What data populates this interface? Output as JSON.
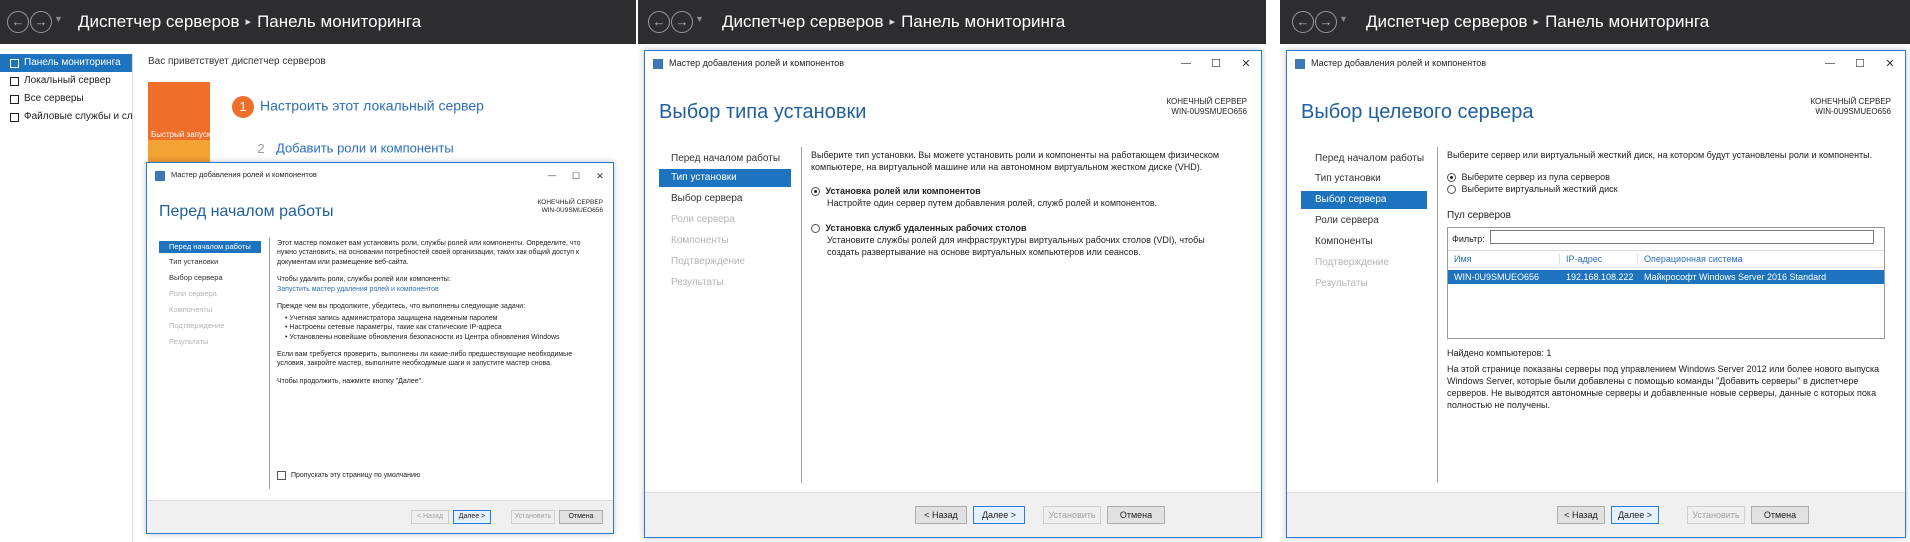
{
  "breadcrumb": {
    "root": "Диспетчер серверов",
    "sep": "▸",
    "current": "Панель мониторинга"
  },
  "dashboard": {
    "sidebar": [
      {
        "label": "Панель мониторинга",
        "icon": "dashboard-icon"
      },
      {
        "label": "Локальный сервер",
        "icon": "server-icon"
      },
      {
        "label": "Все серверы",
        "icon": "servers-icon"
      },
      {
        "label": "Файловые службы и сл...",
        "icon": "file-services-icon"
      }
    ],
    "welcome": "Вас приветствует диспетчер серверов",
    "quick_start": "Быстрый запуск",
    "steps": [
      {
        "num": "1",
        "label": "Настроить этот локальный сервер"
      },
      {
        "num": "2",
        "label": "Добавить роли и компоненты"
      }
    ]
  },
  "wizard_common": {
    "title": "Мастер добавления ролей и компонентов",
    "dest_label": "КОНЕЧНЫЙ СЕРВЕР",
    "dest_server": "WIN-0U9SMUEO656",
    "nav": [
      "Перед началом работы",
      "Тип установки",
      "Выбор сервера",
      "Роли сервера",
      "Компоненты",
      "Подтверждение",
      "Результаты"
    ],
    "buttons": {
      "back": "< Назад",
      "next": "Далее >",
      "install": "Установить",
      "cancel": "Отмена"
    },
    "controls": {
      "minimize": "—",
      "maximize": "☐",
      "close": "✕"
    }
  },
  "wizard1": {
    "heading": "Перед началом работы",
    "intro": "Этот мастер поможет вам установить роли, службы ролей или компоненты. Определите, что нужно установить, на основании потребностей своей организации, таких как общий доступ к документам или размещение веб-сайта.",
    "remove_text": "Чтобы удалить роли, службы ролей или компоненты:",
    "remove_link": "Запустить мастер удаления ролей и компонентов",
    "before_text": "Прежде чем вы продолжите, убедитесь, что выполнены следующие задачи:",
    "tasks": [
      "Учетная запись администратора защищена надежным паролем",
      "Настроены сетевые параметры, такие как статические IP-адреса",
      "Установлены новейшие обновления безопасности из Центра обновления Windows"
    ],
    "verify_text": "Если вам требуется проверить, выполнены ли какие-либо предшествующие необходимые условия, закройте мастер, выполните необходимые шаги и запустите мастер снова.",
    "continue_text": "Чтобы продолжить, нажмите кнопку \"Далее\".",
    "skip_label": "Пропускать эту страницу по умолчанию"
  },
  "wizard2": {
    "heading": "Выбор типа установки",
    "intro": "Выберите тип установки. Вы можете установить роли и компоненты на работающем физическом компьютере, на виртуальной машине или на автономном виртуальном жестком диске (VHD).",
    "options": [
      {
        "title": "Установка ролей или компонентов",
        "desc": "Настройте один сервер путем добавления ролей, служб ролей и компонентов.",
        "selected": true
      },
      {
        "title": "Установка служб удаленных рабочих столов",
        "desc": "Установите службы ролей для инфраструктуры виртуальных рабочих столов (VDI), чтобы создать развертывание на основе виртуальных компьютеров или сеансов.",
        "selected": false
      }
    ]
  },
  "wizard3": {
    "heading": "Выбор целевого сервера",
    "intro": "Выберите сервер или виртуальный жесткий диск, на котором будут установлены роли и компоненты.",
    "options": [
      {
        "label": "Выберите сервер из пула серверов",
        "selected": true
      },
      {
        "label": "Выберите виртуальный жесткий диск",
        "selected": false
      }
    ],
    "pool_title": "Пул серверов",
    "filter_label": "Фильтр:",
    "columns": [
      "Имя",
      "IP-адрес",
      "Операционная система"
    ],
    "rows": [
      [
        "WIN-0U9SMUEO656",
        "192.168.108.222",
        "Майкрософт Windows Server 2016 Standard"
      ]
    ],
    "found": "Найдено компьютеров: 1",
    "note": "На этой странице показаны серверы под управлением Windows Server 2012 или более нового выпуска Windows Server, которые были добавлены с помощью команды \"Добавить серверы\" в диспетчере серверов. Не выводятся автономные серверы и добавленные новые серверы, данные с которых пока полностью не получены."
  },
  "colors": {
    "accent": "#1e73be",
    "title_bar": "#2d2d30",
    "heading": "#1f5f9f",
    "quick_start": "#ef6e2a"
  }
}
